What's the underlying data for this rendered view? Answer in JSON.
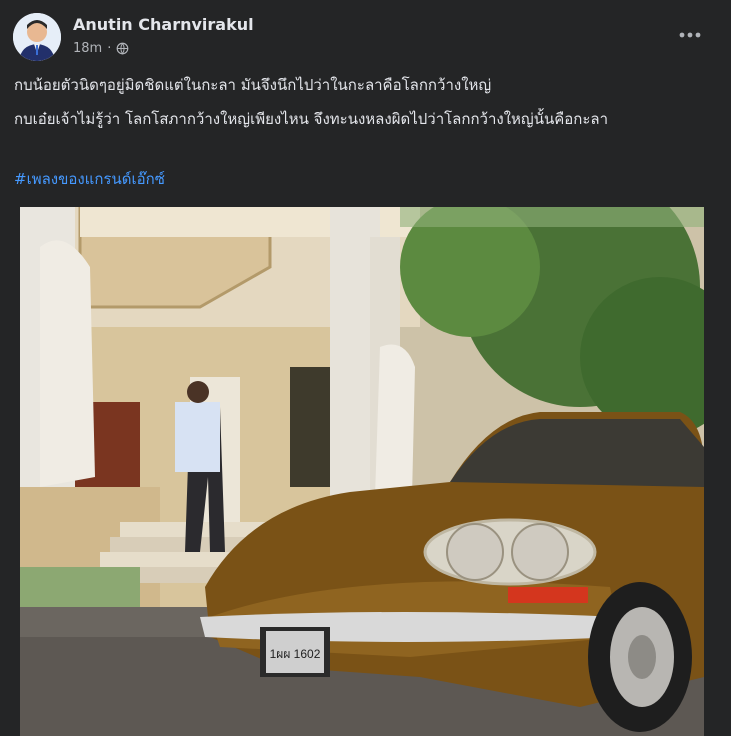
{
  "post": {
    "author": "Anutin Charnvirakul",
    "time": "18m",
    "privacy_icon": "globe-icon",
    "more_icon": "more-dots-icon",
    "text_line1": "กบน้อยตัวนิดๆอยู่มิดชิดแต่ในกะลา มันจึงนึกไปว่าในกะลาคือโลกกว้างใหญ่",
    "text_line2": "กบเอ๋ยเจ้าไม่รู้ว่า โลกโสภากว้างใหญ่เพียงไหน จึงทะนงหลงผิดไปว่าโลกกว้างใหญ่นั้นคือกะลา",
    "hashtag": "#เพลงของแกรนด์เอ๊กซ์",
    "plate_text": "1ผผ 1602"
  },
  "colors": {
    "background": "#242526",
    "text": "#e4e6eb",
    "secondary": "#b0b3b8",
    "link": "#4599ff"
  }
}
